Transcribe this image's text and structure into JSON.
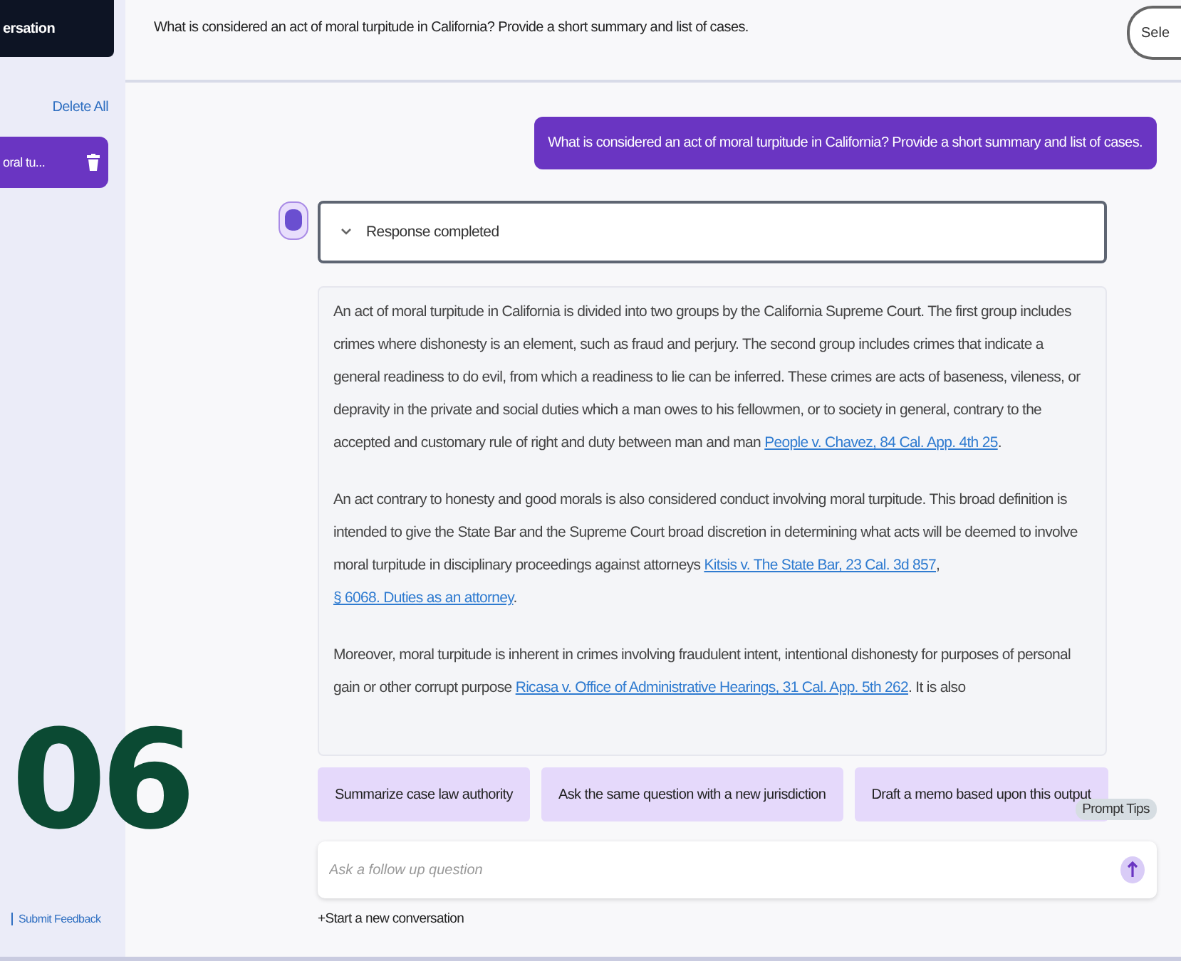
{
  "sidebar": {
    "new_button": "ersation",
    "delete_all": "Delete All",
    "history": [
      {
        "label": "oral tu...",
        "selected": true
      }
    ],
    "feedback": "Submit Feedback"
  },
  "header": {
    "question": "What is considered an act of moral turpitude in California? Provide a short summary and list of cases.",
    "button": "Sele"
  },
  "user_message": "What is considered an act of moral turpitude in California? Provide a short summary and list of cases.",
  "response_status": {
    "label": "Response completed",
    "expanded": false
  },
  "answer": [
    [
      {
        "kind": "text",
        "text": "An act of moral turpitude in California is divided into two groups by the California Supreme Court. The first group includes crimes where dishonesty is an element, such as fraud and perjury. The second group includes crimes that indicate a general readiness to do evil, from which a readiness to lie can be inferred. These crimes are acts of baseness, vileness, or depravity in the private and social duties which a man owes to his fellowmen, or to society in general, contrary to the accepted and customary rule of right and duty between man and man "
      },
      {
        "kind": "link",
        "text": "People v. Chavez, 84 Cal. App. 4th 25"
      },
      {
        "kind": "text",
        "text": "."
      }
    ],
    [
      {
        "kind": "text",
        "text": "An act contrary to honesty and good morals is also considered conduct involving moral turpitude. This broad definition is intended to give the State Bar and the Supreme Court broad discretion in determining what acts will be deemed to involve moral turpitude in disciplinary proceedings against attorneys "
      },
      {
        "kind": "link",
        "text": "Kitsis v. The State Bar, 23 Cal. 3d 857"
      },
      {
        "kind": "text",
        "text": ", "
      },
      {
        "kind": "link",
        "text": "§ 6068. Duties as an attorney"
      },
      {
        "kind": "text",
        "text": "."
      }
    ],
    [
      {
        "kind": "text",
        "text": "Moreover, moral turpitude is inherent in crimes involving fraudulent intent, intentional dishonesty for purposes of personal gain or other corrupt purpose "
      },
      {
        "kind": "link",
        "text": "Ricasa v. Office of Administrative Hearings, 31 Cal. App. 5th 262"
      },
      {
        "kind": "text",
        "text": ". It is also"
      }
    ]
  ],
  "suggestions": [
    "Summarize case law authority",
    "Ask the same question with a new jurisdiction",
    "Draft a memo based upon this output"
  ],
  "prompt_tips": "Prompt Tips",
  "input": {
    "placeholder": "Ask a follow up question"
  },
  "new_conversation": "+Start a new conversation",
  "step_number": "06"
}
